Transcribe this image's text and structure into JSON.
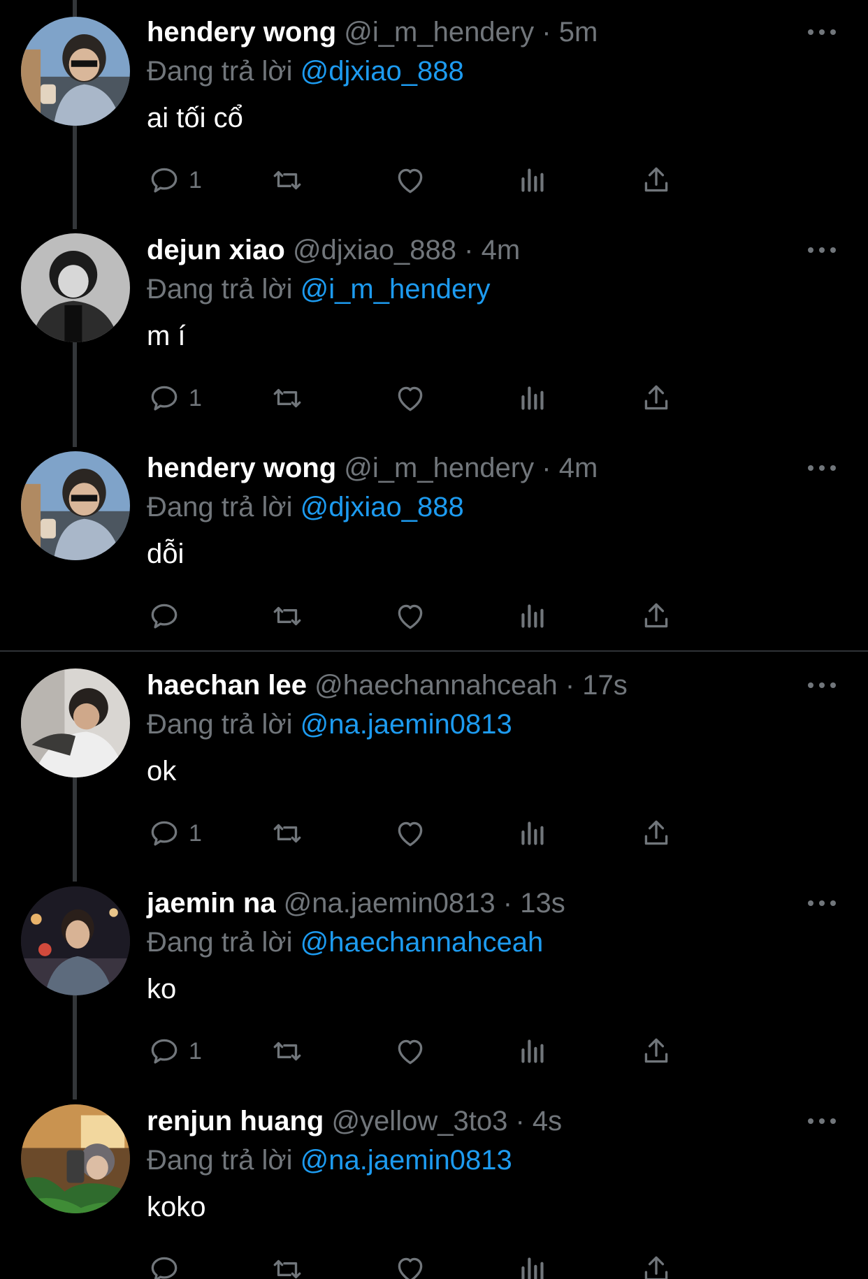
{
  "tweets": [
    {
      "name": "hendery wong",
      "handle": "@i_m_hendery",
      "sep": "·",
      "time": "5m",
      "replying_label": "Đang trả lời",
      "replying_to": "@djxiao_888",
      "text": "ai tối cổ",
      "reply_count": "1"
    },
    {
      "name": "dejun xiao",
      "handle": "@djxiao_888",
      "sep": "·",
      "time": "4m",
      "replying_label": "Đang trả lời",
      "replying_to": "@i_m_hendery",
      "text": "m í",
      "reply_count": "1"
    },
    {
      "name": "hendery wong",
      "handle": "@i_m_hendery",
      "sep": "·",
      "time": "4m",
      "replying_label": "Đang trả lời",
      "replying_to": "@djxiao_888",
      "text": "dỗi",
      "reply_count": ""
    },
    {
      "name": "haechan lee",
      "handle": "@haechannahceah",
      "sep": "·",
      "time": "17s",
      "replying_label": "Đang trả lời",
      "replying_to": "@na.jaemin0813",
      "text": "ok",
      "reply_count": "1"
    },
    {
      "name": "jaemin na",
      "handle": "@na.jaemin0813",
      "sep": "·",
      "time": "13s",
      "replying_label": "Đang trả lời",
      "replying_to": "@haechannahceah",
      "text": "ko",
      "reply_count": "1"
    },
    {
      "name": "renjun huang",
      "handle": "@yellow_3to3",
      "sep": "·",
      "time": "4s",
      "replying_label": "Đang trả lời",
      "replying_to": "@na.jaemin0813",
      "text": "koko",
      "reply_count": ""
    }
  ],
  "icons": {
    "reply": "reply-icon",
    "retweet": "retweet-icon",
    "like": "heart-icon",
    "views": "views-icon",
    "share": "share-icon",
    "more": "more-icon"
  },
  "colors": {
    "background": "#000000",
    "text": "#ffffff",
    "secondary": "#71767b",
    "link": "#1d9bf0",
    "thread_line": "#333639"
  }
}
